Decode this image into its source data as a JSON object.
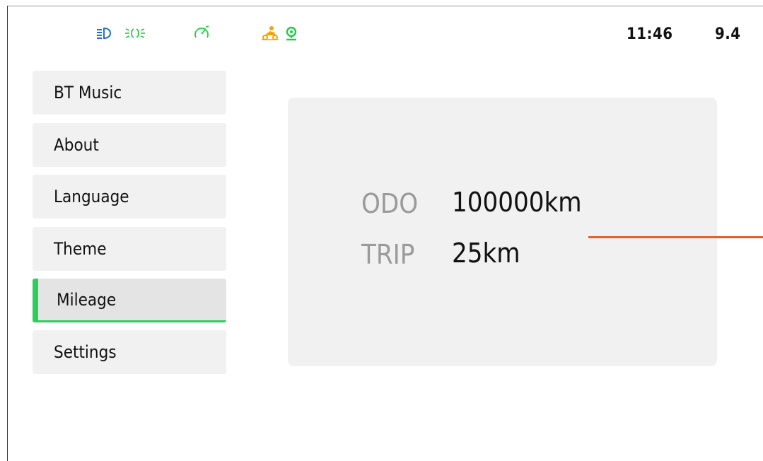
{
  "status_bar": {
    "icons": [
      "low-beam-icon",
      "parking-light-icon",
      "speedometer-icon",
      "motorcycle-icon",
      "gps-icon"
    ],
    "colors": {
      "beam": "#1f6fd6",
      "green": "#22cc44",
      "orange": "#f5a300"
    },
    "time": "11:46",
    "voltage": "9.4"
  },
  "menu": {
    "items": [
      {
        "label": "BT Music"
      },
      {
        "label": "About"
      },
      {
        "label": "Language"
      },
      {
        "label": "Theme"
      },
      {
        "label": "Mileage",
        "active": true
      },
      {
        "label": "Settings"
      }
    ],
    "accent_color": "#2ecc5c"
  },
  "mileage": {
    "odo_label": "ODO",
    "odo_value": "100000km",
    "trip_label": "TRIP",
    "trip_value": "25km"
  },
  "pointer_line_color": "#e2622e"
}
